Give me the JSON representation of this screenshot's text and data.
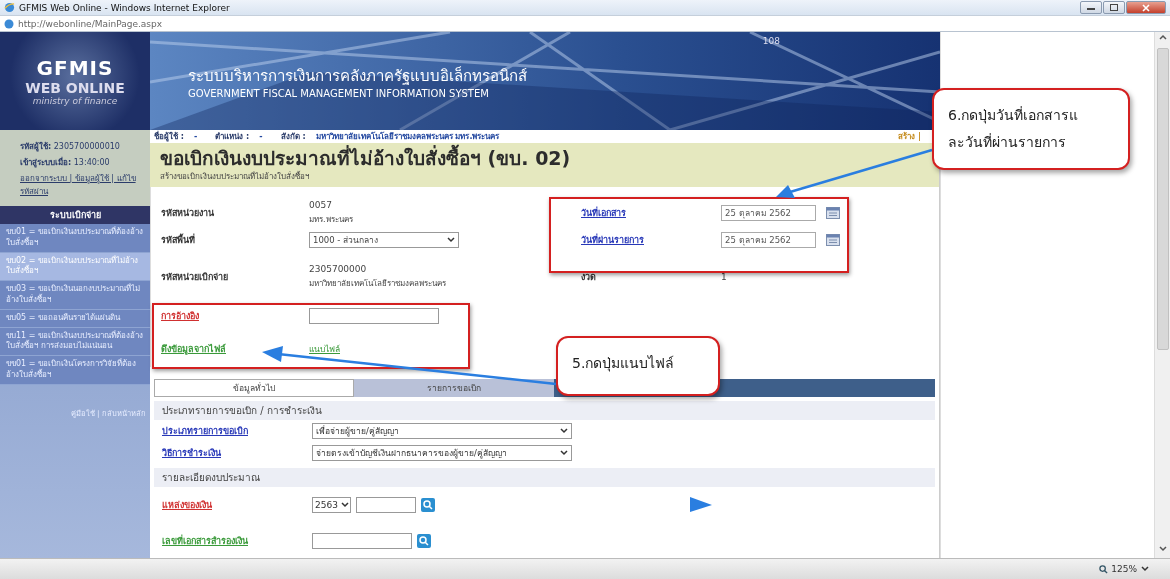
{
  "window": {
    "title": "GFMIS Web Online - Windows Internet Explorer",
    "address": "http://webonline/MainPage.aspx",
    "zoom": "125%"
  },
  "logo": {
    "line1": "GFMIS",
    "line2": "WEB ONLINE",
    "line3": "ministry of finance"
  },
  "banner": {
    "title_th": "ระบบบริหารการเงินการคลังภาครัฐแบบอิเล็กทรอนิกส์",
    "title_en": "GOVERNMENT FISCAL MANAGEMENT INFORMATION SYSTEM",
    "number": "108"
  },
  "user": {
    "id_label": "รหัสผู้ใช้:",
    "id": "2305700000010",
    "login_label": "เข้าสู่ระบบเมื่อ:",
    "login_time": "13:40:00",
    "links": "ออกจากระบบ | ข้อมูลผู้ใช้ | แก้ไขรหัสผ่าน"
  },
  "menu": {
    "title": "ระบบเบิกจ่าย",
    "items": [
      {
        "label": "ขบ01 = ขอเบิกเงินงบประมาณที่ต้องอ้างใบสั่งซื้อฯ",
        "selected": false
      },
      {
        "label": "ขบ02 = ขอเบิกเงินงบประมาณที่ไม่อ้างใบสั่งซื้อฯ",
        "selected": true
      },
      {
        "label": "ขบ03 = ขอเบิกเงินนอกงบประมาณที่ไม่อ้างใบสั่งซื้อฯ",
        "selected": false
      },
      {
        "label": "ขบ05 = ขอถอนคืนรายได้แผ่นดิน",
        "selected": false
      },
      {
        "label": "ขบ11 = ขอเบิกเงินงบประมาณที่ต้องอ้างใบสั่งซื้อฯ การส่งมอบไม่แน่นอน",
        "selected": false
      },
      {
        "label": "ขข01 = ขอเบิกเงินโครงการวิจัยที่ต้องอ้างใบสั่งซื้อฯ",
        "selected": false
      }
    ],
    "footer": "คู่มือใช้ | กลับหน้าหลัก"
  },
  "info_bar": [
    {
      "label": "ชื่อผู้ใช้ :",
      "value": "-"
    },
    {
      "label": "ตำแหน่ง :",
      "value": "-"
    },
    {
      "label": "สังกัด :",
      "value": "มหาวิทยาลัยเทคโนโลยีราชมงคลพระนคร มทร.พระนคร"
    }
  ],
  "info_action": "สร้าง |",
  "page": {
    "title": "ขอเบิกเงินงบประมาณที่ไม่อ้างใบสั่งซื้อฯ (ขบ. 02)",
    "subtitle": "สร้างขอเบิกเงินงบประมาณที่ไม่อ้างใบสั่งซื้อฯ"
  },
  "form": {
    "left": [
      {
        "label": "รหัสหน่วยงาน",
        "kind": "text",
        "value": "0057",
        "note": "มทร.พระนคร"
      },
      {
        "label": "รหัสพื้นที่",
        "kind": "select",
        "value": "1000 - ส่วนกลาง"
      },
      {
        "label": "รหัสหน่วยเบิกจ่าย",
        "kind": "text",
        "value": "2305700000",
        "note": "มหาวิทยาลัยเทคโนโลยีราชมงคลพระนคร"
      },
      {
        "label": "การอ้างอิง",
        "kind": "input"
      },
      {
        "label": "ดึงข้อมูลจากไฟล์",
        "kind": "link",
        "value": "แนบไฟล์"
      }
    ],
    "right": [
      {
        "label": "วันที่เอกสาร",
        "kind": "date",
        "value": "25 ตุลาคม 2562"
      },
      {
        "label": "วันที่ผ่านรายการ",
        "kind": "date",
        "value": "25 ตุลาคม 2562"
      },
      {
        "label": "งวด",
        "kind": "text",
        "value": "1"
      }
    ]
  },
  "tabs": [
    {
      "label": "ข้อมูลทั่วไป",
      "selected": true
    },
    {
      "label": "รายการขอเบิก",
      "selected": false
    }
  ],
  "sections": [
    {
      "title": "ประเภทรายการขอเบิก / การชำระเงิน",
      "rows": [
        {
          "label": "ประเภทรายการขอเบิก",
          "kind": "select",
          "value": "เพื่อจ่ายผู้ขาย/คู่สัญญา"
        },
        {
          "label": "วิธีการชำระเงิน",
          "kind": "select",
          "value": "จ่ายตรงเข้าบัญชีเงินฝากธนาคารของผู้ขาย/คู่สัญญา"
        }
      ]
    },
    {
      "title": "รายละเอียดงบประมาณ",
      "rows": [
        {
          "label": "แหล่งของเงิน",
          "kind": "year_lookup",
          "value": "2563"
        },
        {
          "label": "เลขที่เอกสารสำรองเงิน",
          "kind": "lookup"
        }
      ]
    }
  ],
  "callouts": [
    {
      "lines": [
        "6.กดปุ่มวันที่เอกสารแ",
        "ละวันที่ผ่านรายการ"
      ]
    },
    {
      "lines": [
        "5.กดปุ่มแนบไฟล์"
      ]
    }
  ]
}
